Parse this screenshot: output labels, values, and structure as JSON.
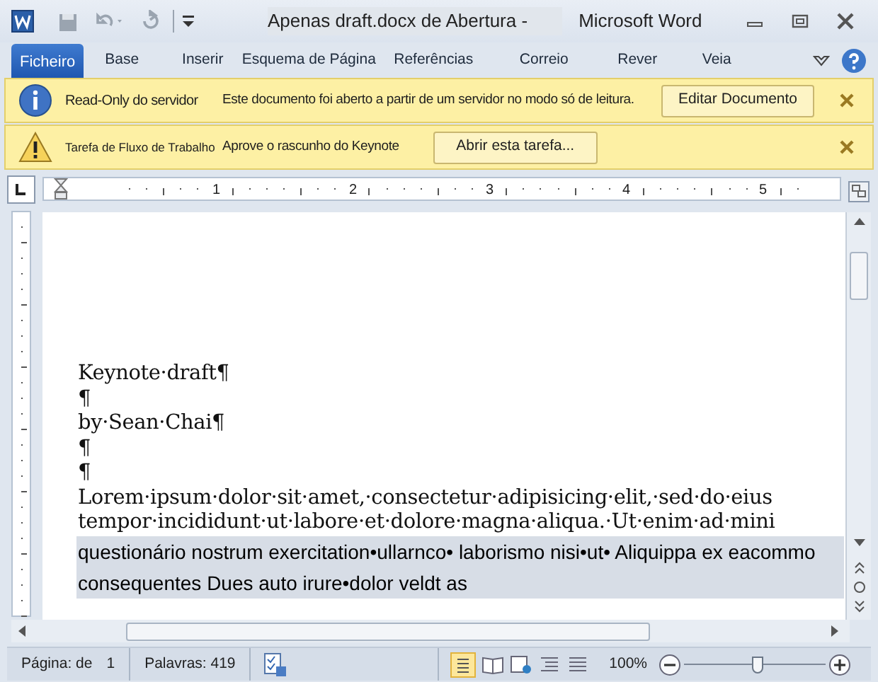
{
  "title_bar": {
    "document": "Apenas draft.docx de Abertura -",
    "app": "Microsoft Word"
  },
  "tabs": [
    {
      "label": "Ficheiro",
      "kind": "file"
    },
    {
      "label": "Base",
      "kind": "tab"
    },
    {
      "label": "Inserir",
      "kind": "tab"
    },
    {
      "label": "Esquema de Página",
      "kind": "tab"
    },
    {
      "label": "Referências",
      "kind": "tab"
    },
    {
      "label": "Correio",
      "kind": "tab"
    },
    {
      "label": "Rever",
      "kind": "tab"
    },
    {
      "label": "Veia",
      "kind": "tab"
    }
  ],
  "message_bars": [
    {
      "kind": "info",
      "title": "Read-Only do servidor",
      "message": "Este documento foi aberto a partir de um servidor no modo só de leitura.",
      "button": "Editar Documento"
    },
    {
      "kind": "warning",
      "title": "Tarefa de Fluxo de Trabalho",
      "message": "Aprove o rascunho do Keynote",
      "button": "Abrir esta tarefa..."
    }
  ],
  "ruler": {
    "labels": [
      "1",
      "2",
      "3",
      "4",
      "5"
    ]
  },
  "document": {
    "lines": [
      {
        "text": "Keynote·draft¶",
        "selected": false
      },
      {
        "text": "¶",
        "selected": false
      },
      {
        "text": "by·Sean·Chai¶",
        "selected": false
      },
      {
        "text": "¶",
        "selected": false
      },
      {
        "text": "¶",
        "selected": false
      },
      {
        "text": "Lorem·ipsum·dolor·sit·amet,·consectetur·adipisicing·elit,·sed·do·eius",
        "selected": false
      },
      {
        "text": "tempor·incididunt·ut·labore·et·dolore·magna·aliqua.·Ut·enim·ad·mini",
        "selected": false
      },
      {
        "text": "questionário nostrum exercitation•ullarnco• laborismo nisi•ut• Aliquippa ex eacommo",
        "selected": true
      },
      {
        "text": "consequentes Dues auto irure•dolor veldt as",
        "selected": true
      }
    ]
  },
  "status_bar": {
    "page_label": "Página: de",
    "page": "1",
    "words": "Palavras: 419",
    "zoom": "100%",
    "zoom_level": {
      "level": 0.52
    }
  }
}
